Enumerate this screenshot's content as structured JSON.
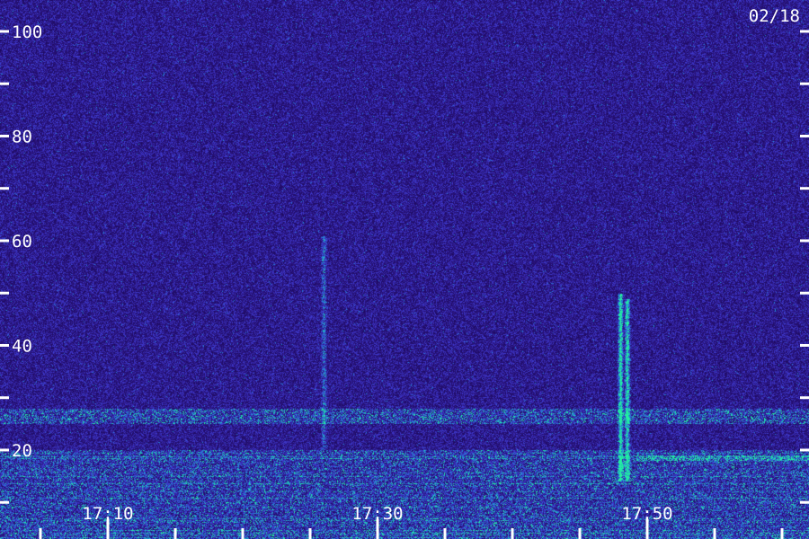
{
  "chart_data": {
    "type": "heatmap",
    "date_label": "02/18",
    "y_ticks": [
      {
        "value": 100,
        "label": "100"
      },
      {
        "value": 80,
        "label": "80"
      },
      {
        "value": 60,
        "label": "60"
      },
      {
        "value": 40,
        "label": "40"
      },
      {
        "value": 20,
        "label": "20"
      }
    ],
    "y_minor_ticks": [
      90,
      70,
      50,
      30,
      10
    ],
    "x_ticks": [
      {
        "value": "17:10",
        "label": "17:10"
      },
      {
        "value": "17:30",
        "label": "17:30"
      },
      {
        "value": "17:50",
        "label": "17:50"
      }
    ],
    "x_minor_ticks": [
      "17:05",
      "17:15",
      "17:20",
      "17:25",
      "17:35",
      "17:40",
      "17:45",
      "17:55",
      "18:00"
    ],
    "xlim": [
      "17:02",
      "18:02"
    ],
    "ylim": [
      3,
      106
    ],
    "colors": {
      "background": "#1d0a5e",
      "noise_low": "#2a1480",
      "noise_high": "#3f3ad0",
      "signal_mid": "#1f8fd8",
      "signal_high": "#23f0a0",
      "text": "#ffffff"
    },
    "features": [
      {
        "kind": "band",
        "y_from": 25,
        "y_to": 28,
        "x_from": "17:02",
        "x_to": "18:02",
        "intensity": 0.55
      },
      {
        "kind": "band",
        "y_from": 3,
        "y_to": 20,
        "x_from": "17:02",
        "x_to": "18:02",
        "intensity": 0.45
      },
      {
        "kind": "burst",
        "x": "17:26",
        "y_from": 20,
        "y_to": 61,
        "intensity": 0.45
      },
      {
        "kind": "burst",
        "x": "17:48",
        "y_from": 14,
        "y_to": 50,
        "intensity": 1.0
      },
      {
        "kind": "burst",
        "x": "17:48.5",
        "y_from": 14,
        "y_to": 49,
        "intensity": 0.95
      },
      {
        "kind": "band",
        "y_from": 18,
        "y_to": 19,
        "x_from": "17:49",
        "x_to": "18:02",
        "intensity": 0.7
      }
    ]
  }
}
